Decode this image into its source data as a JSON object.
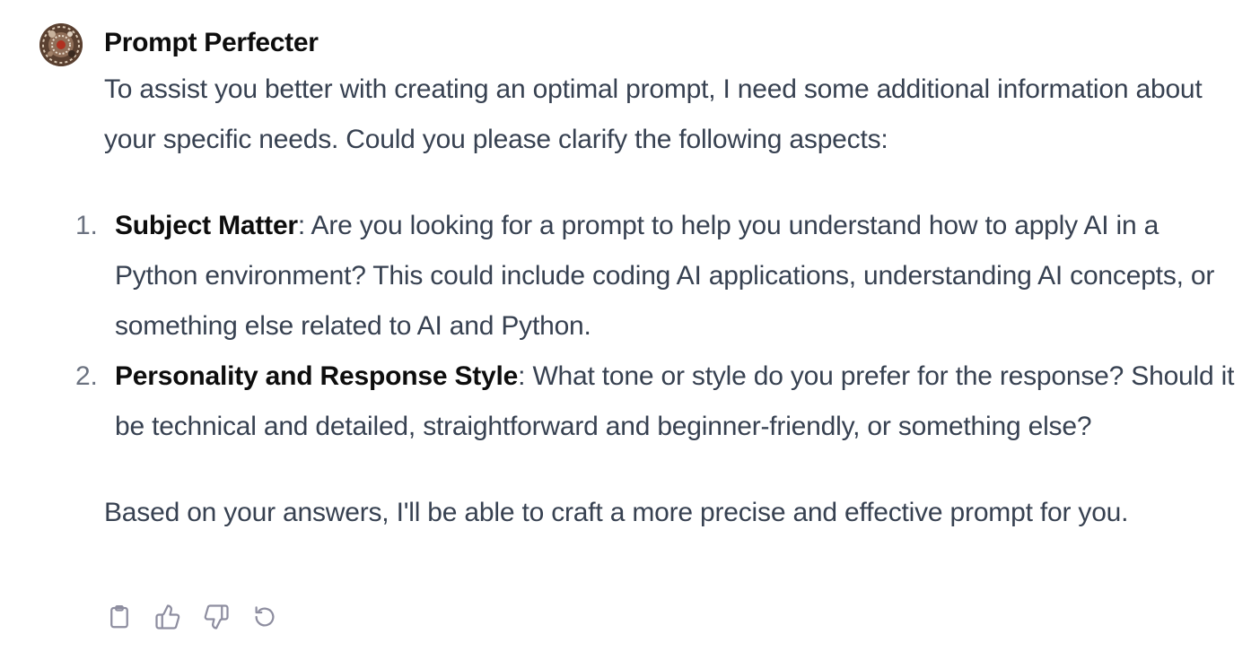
{
  "message": {
    "author": "Prompt Perfecter",
    "intro": "To assist you better with creating an optimal prompt, I need some additional information about your specific needs. Could you please clarify the following aspects:",
    "aspects": [
      {
        "number": "1.",
        "term": "Subject Matter",
        "text": ": Are you looking for a prompt to help you understand how to apply AI in a Python environment? This could include coding AI applications, understanding AI concepts, or something else related to AI and Python."
      },
      {
        "number": "2.",
        "term": "Personality and Response Style",
        "text": ": What tone or style do you prefer for the response? Should it be technical and detailed, straightforward and beginner-friendly, or something else?"
      }
    ],
    "closing": "Based on your answers, I'll be able to craft a more precise and effective prompt for you."
  },
  "actions": [
    {
      "icon": "clipboard-icon"
    },
    {
      "icon": "thumbs-up-icon"
    },
    {
      "icon": "thumbs-down-icon"
    },
    {
      "icon": "regenerate-icon"
    }
  ],
  "colors": {
    "text": "#374151",
    "author": "#0d0d0d",
    "icon": "#8e8ea0",
    "list_number": "#6b7280"
  }
}
